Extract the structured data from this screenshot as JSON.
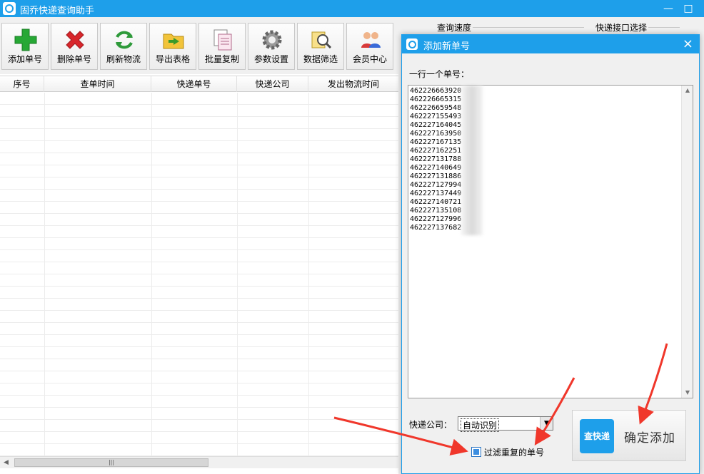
{
  "window": {
    "title": "固乔快递查询助手",
    "minimize": "—",
    "maximize": "□"
  },
  "toolbar": [
    {
      "label": "添加单号",
      "icon": "add-plus-icon"
    },
    {
      "label": "删除单号",
      "icon": "delete-x-icon"
    },
    {
      "label": "刷新物流",
      "icon": "refresh-icon"
    },
    {
      "label": "导出表格",
      "icon": "export-folder-icon"
    },
    {
      "label": "批量复制",
      "icon": "copy-icon"
    },
    {
      "label": "参数设置",
      "icon": "gear-icon"
    },
    {
      "label": "数据筛选",
      "icon": "filter-search-icon"
    },
    {
      "label": "会员中心",
      "icon": "members-icon"
    }
  ],
  "table": {
    "columns": [
      "序号",
      "查单时间",
      "快递单号",
      "快递公司",
      "发出物流时间"
    ]
  },
  "right_panel": {
    "speed_label": "查询速度",
    "interface_label": "快递接口选择"
  },
  "dialog": {
    "title": "添加新单号",
    "close": "×",
    "hint": "一行一个单号：",
    "numbers": [
      "462226663920",
      "462226665315",
      "462226659548",
      "462227155493",
      "462227164045",
      "462227163950",
      "462227167135",
      "462227162251",
      "462227131788",
      "462227140649",
      "462227131886",
      "462227127994",
      "462227137449",
      "462227140721",
      "462227135108",
      "462227127996",
      "462227137682"
    ],
    "company_label": "快递公司：",
    "company_value": "自动识别",
    "filter_label": "过滤重复的单号",
    "confirm_logo": "查快递",
    "confirm_label": "确定添加"
  },
  "scroll": {
    "thumb": "|||"
  },
  "colors": {
    "accent": "#1e9fea",
    "arrow": "#f0372b"
  }
}
